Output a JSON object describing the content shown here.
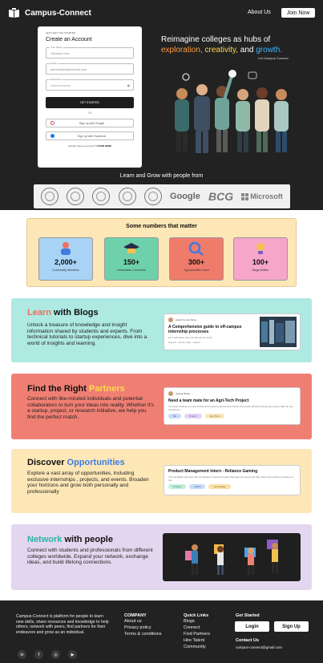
{
  "header": {
    "brand": "Campus-Connect",
    "nav_about": "About Us",
    "join_label": "Join Now"
  },
  "signup": {
    "kicker": "LET'S GET YOU STARTED",
    "title": "Create an Account",
    "name_label": "Your Name",
    "name_value": "Johnson Doe",
    "email_label": "Email",
    "email_value": "johnsondoe@nomail.com",
    "password_label": "Password",
    "password_value": "••••••••••••••••••",
    "get_started": "GET STARTED",
    "or": "Or",
    "google_label": "Sign up with Google",
    "facebook_label": "Sign up with Facebook",
    "already_text": "Already have an account?",
    "login_here": "LOGIN HERE"
  },
  "hero": {
    "tagline_line1": "Reimagine colleges as hubs of",
    "word1": "exploration,",
    "word2": "creativity,",
    "and": "and",
    "word3": "growth.",
    "tagline_source": "Let Campus Connect",
    "learn_grow": "Learn and Grow with people from",
    "brands": [
      "Google",
      "BCG",
      "Microsoft"
    ]
  },
  "numbers": {
    "title": "Some numbers that matter",
    "stats": [
      {
        "value": "2,000+",
        "label": "Community Members",
        "color": "#a9d3f5"
      },
      {
        "value": "150+",
        "label": "Universities Connected",
        "color": "#6fd1ab"
      },
      {
        "value": "300+",
        "label": "Opportunities Listed",
        "color": "#ef7b6b"
      },
      {
        "value": "100+",
        "label": "Blogs Written",
        "color": "#f6a6c8"
      }
    ]
  },
  "blogs": {
    "title_accent": "Learn",
    "title_rest": " with Blogs",
    "accent_color": "#ef6f5e",
    "bg": "#aee9e2",
    "text": "Unlock a treasure of knowledge and insight information shared by students and experts. From technical tutorials to startup experiences, dive into a world of insights and learning.",
    "card": {
      "author": "Akash Kumar Mitra",
      "title": "A Comprehensive guide to off-campus internship processes",
      "desc": "Let's talk about how you can get an intern",
      "meta": "Aug 24 · 10 min read · Career"
    }
  },
  "partners": {
    "title_rest": "Find the Right ",
    "title_accent": "Partners",
    "accent_color": "#ffd84a",
    "bg": "#f07f73",
    "text": "Connect with like-minded individuals and potential collaborators to turn your ideas into reality. Whether it's a startup, project, or research initiative, we help you find the perfect match.",
    "card": {
      "author": "Natwar Bhatti",
      "title": "Need a team mate for an Agri-Tech Project",
      "desc": "I've been working on (own and AI tech model to tell harmful insects and pests without) looking the picture with the use of features...",
      "tags": [
        "ML",
        "Project",
        "Agri-Tech"
      ]
    }
  },
  "opps": {
    "title_rest": "Discover ",
    "title_accent": "Opportunities",
    "accent_color": "#3f7be0",
    "bg": "#fde7b7",
    "text": "Explore a vast array of opportunities, including exclusive internships , projects, and events. Broaden your horizons and grow both personally and professionally",
    "card": {
      "title": "Product Management Intern - Reliance Gaming",
      "desc": "The candidate will work with the Reliance Games Product Management team and their daily and monthly exercises of the...",
      "tags": [
        "Product",
        "UI/UX",
        "Technology"
      ]
    }
  },
  "network": {
    "title_accent": "Network",
    "title_rest": " with people",
    "accent_color": "#2bb3a6",
    "bg": "#e3d6ef",
    "text": "Connect with students and professionals from different colleges worldwide. Expand your network, exchange ideas, and build lifelong connections."
  },
  "footer": {
    "about": "Campus-Connect is platform for people to learn new skills, share resources and knowledge to help others, network with peers, find partners for their endeavors and grow as an individual.",
    "company_head": "COMPANY",
    "company_links": [
      "About us",
      "Privacy policy",
      "Terms & conditions"
    ],
    "quick_head": "Quick Links",
    "quick_links": [
      "Blogs",
      "Connect",
      "Find Partners",
      "Hire Talent",
      "Community"
    ],
    "get_started_head": "Get Started",
    "login": "Login",
    "signup": "Sign Up",
    "contact_head": "Contact Us",
    "email": "campus-connect@gmail.com",
    "socials": [
      "linkedin-icon",
      "facebook-icon",
      "instagram-icon",
      "youtube-icon"
    ]
  }
}
